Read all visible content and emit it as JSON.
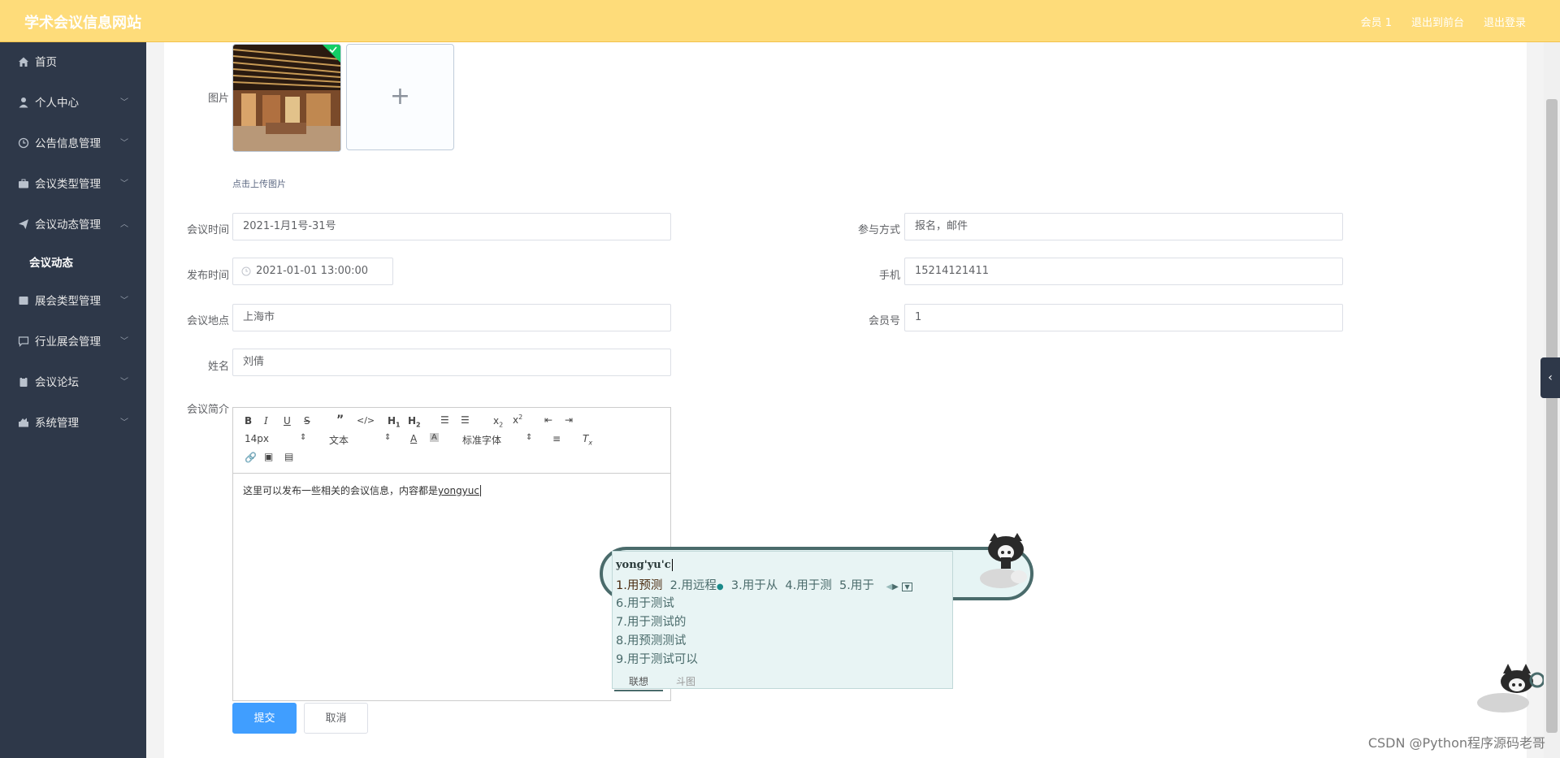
{
  "header": {
    "title": "学术会议信息网站",
    "links": [
      "会员 1",
      "退出到前台",
      "退出登录"
    ]
  },
  "sidebar": {
    "items": [
      {
        "label": "首页",
        "icon": "home-icon",
        "expandable": false
      },
      {
        "label": "个人中心",
        "icon": "user-icon",
        "expandable": true
      },
      {
        "label": "公告信息管理",
        "icon": "clock-icon",
        "expandable": true
      },
      {
        "label": "会议类型管理",
        "icon": "briefcase-icon",
        "expandable": true
      },
      {
        "label": "会议动态管理",
        "icon": "send-icon",
        "expandable": true,
        "expanded": true,
        "children": [
          "会议动态"
        ]
      },
      {
        "label": "展会类型管理",
        "icon": "box-icon",
        "expandable": true
      },
      {
        "label": "行业展会管理",
        "icon": "chat-icon",
        "expandable": true
      },
      {
        "label": "会议论坛",
        "icon": "clipboard-icon",
        "expandable": true
      },
      {
        "label": "系统管理",
        "icon": "settings-icon",
        "expandable": true
      }
    ]
  },
  "form": {
    "image_label": "图片",
    "upload_tip": "点击上传图片",
    "meeting_time_label": "会议时间",
    "meeting_time_value": "2021-1月1号-31号",
    "participation_label": "参与方式",
    "participation_value": "报名，邮件",
    "publish_time_label": "发布时间",
    "publish_time_value": "2021-01-01 13:00:00",
    "phone_label": "手机",
    "phone_value": "15214121411",
    "location_label": "会议地点",
    "location_value": "上海市",
    "member_no_label": "会员号",
    "member_no_value": "1",
    "name_label": "姓名",
    "name_value": "刘倩",
    "intro_label": "会议简介",
    "submit_label": "提交",
    "cancel_label": "取消"
  },
  "editor": {
    "font_size": "14px",
    "block_format": "文本",
    "font_family": "标准字体",
    "content_text": "这里可以发布一些相关的会议信息，内容都是",
    "content_typing": "yongyuc"
  },
  "ime": {
    "composition": "yong'yu'c",
    "row1": [
      "1.用预测",
      "2.用远程",
      "3.用于从",
      "4.用于测",
      "5.用于"
    ],
    "list": [
      "6.用于测试",
      "7.用于测试的",
      "8.用预测测试",
      "9.用于测试可以"
    ],
    "tabs": [
      "联想",
      "斗图"
    ]
  },
  "watermark": "CSDN @Python程序源码老哥"
}
